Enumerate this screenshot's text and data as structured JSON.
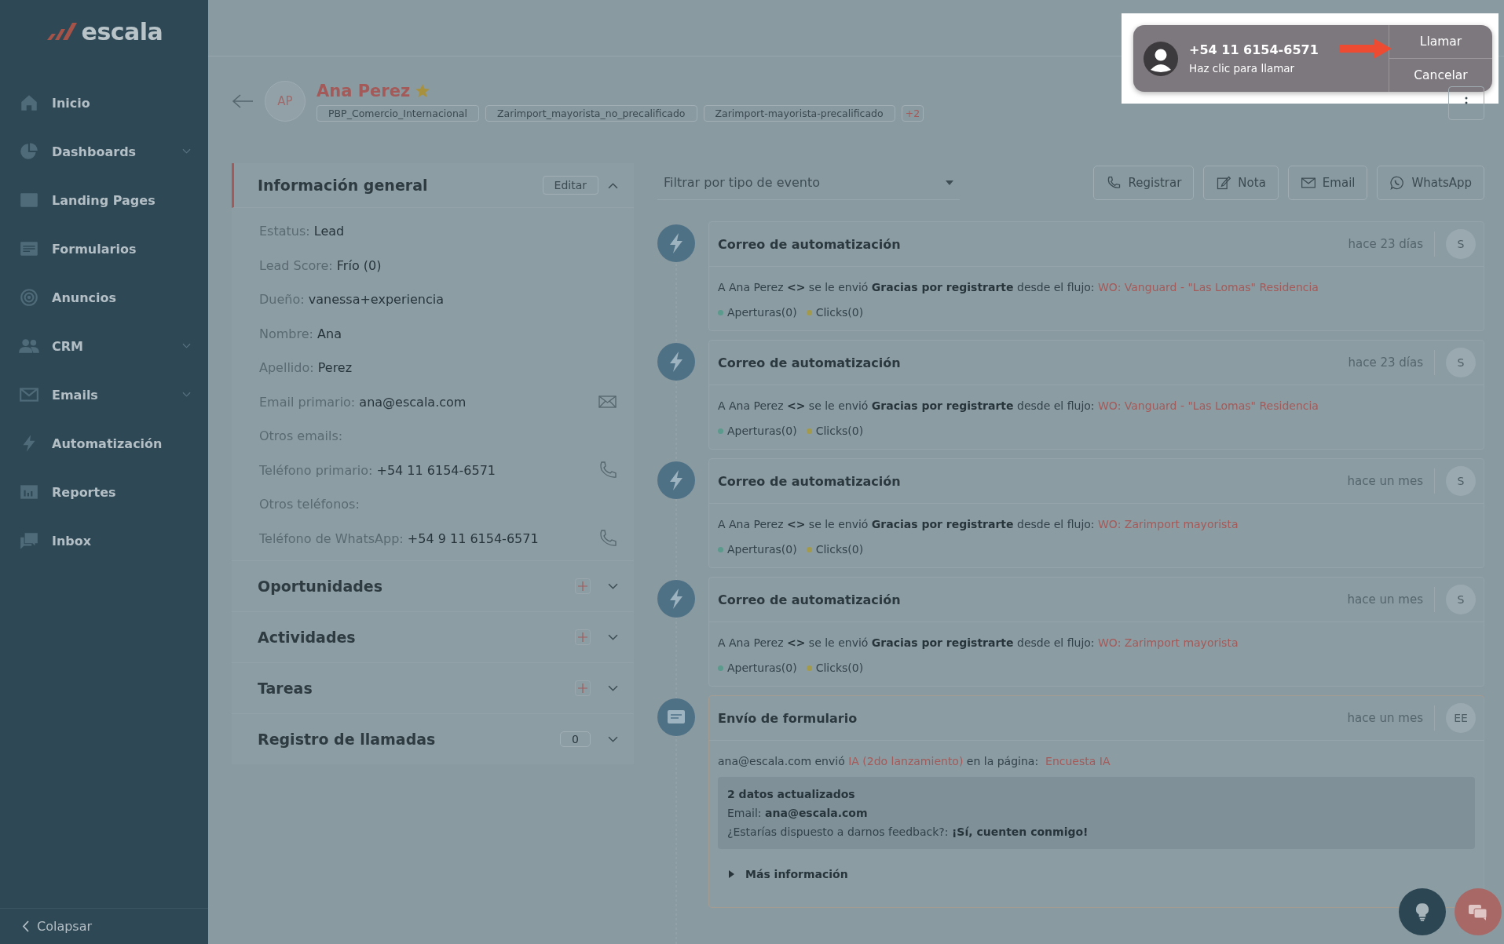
{
  "sidebar": {
    "logo": "escala",
    "items": [
      {
        "label": "Inicio",
        "expandable": false
      },
      {
        "label": "Dashboards",
        "expandable": true
      },
      {
        "label": "Landing Pages",
        "expandable": false
      },
      {
        "label": "Formularios",
        "expandable": false
      },
      {
        "label": "Anuncios",
        "expandable": false
      },
      {
        "label": "CRM",
        "expandable": true
      },
      {
        "label": "Emails",
        "expandable": true
      },
      {
        "label": "Automatización",
        "expandable": false
      },
      {
        "label": "Reportes",
        "expandable": false
      },
      {
        "label": "Inbox",
        "expandable": false
      }
    ],
    "collapse": "Colapsar"
  },
  "contact": {
    "initials": "AP",
    "name": "Ana Perez",
    "starred": true,
    "tags": [
      "PBP_Comercio_Internacional",
      "Zarimport_mayorista_no_precalificado",
      "Zarimport-mayorista-precalificado"
    ],
    "more_tags": "+2"
  },
  "call_popup": {
    "number": "+54 11 6154-6571",
    "hint": "Haz clic para llamar",
    "buttons": [
      "Llamar",
      "Cancelar"
    ]
  },
  "info_panel": {
    "title": "Información general",
    "edit": "Editar",
    "expanded": true,
    "fields": [
      {
        "kind": "text",
        "label": "Estatus:",
        "value": "Lead"
      },
      {
        "kind": "text",
        "label": "Lead Score:",
        "value": "Frío (0)"
      },
      {
        "kind": "text",
        "label": "Dueño:",
        "value": "vanessa+experiencia"
      },
      {
        "kind": "text",
        "label": "Nombre:",
        "value": "Ana"
      },
      {
        "kind": "text",
        "label": "Apellido:",
        "value": "Perez"
      },
      {
        "kind": "email",
        "label": "Email primario:",
        "value": "ana@escala.com"
      },
      {
        "kind": "text",
        "label": "Otros emails:"
      },
      {
        "kind": "phone",
        "label": "Teléfono primario:",
        "value": "+54 11 6154-6571"
      },
      {
        "kind": "text",
        "label": "Otros teléfonos:"
      },
      {
        "kind": "phone",
        "label": "Teléfono de WhatsApp:",
        "value": "+54 9 11 6154-6571"
      }
    ],
    "sections": [
      {
        "title": "Oportunidades",
        "kind": "add"
      },
      {
        "title": "Actividades",
        "kind": "add"
      },
      {
        "title": "Tareas",
        "kind": "add"
      },
      {
        "title": "Registro de llamadas",
        "kind": "count",
        "count": "0"
      }
    ]
  },
  "timeline": {
    "filter": {
      "placeholder": "Filtrar por tipo de evento"
    },
    "actions": [
      "Registrar",
      "Nota",
      "Email",
      "WhatsApp"
    ],
    "events": [
      {
        "kind": "automation",
        "title": "Correo de automatización",
        "time": "hace 23 días",
        "avatar": "S",
        "text": "A Ana Perez **<>** se le envió **Gracias por registrarte** desde el flujo:",
        "link": "WO: Vanguard - \"Las Lomas\" Residencia",
        "stats": [
          {
            "label": "Aperturas(0)",
            "color": "#5b9a8c"
          },
          {
            "label": "Clicks(0)",
            "color": "#a39a4c"
          }
        ]
      },
      {
        "kind": "automation",
        "title": "Correo de automatización",
        "time": "hace 23 días",
        "avatar": "S",
        "text": "A Ana Perez **<>** se le envió **Gracias por registrarte** desde el flujo:",
        "link": "WO: Vanguard - \"Las Lomas\" Residencia",
        "stats": [
          {
            "label": "Aperturas(0)",
            "color": "#5b9a8c"
          },
          {
            "label": "Clicks(0)",
            "color": "#a39a4c"
          }
        ]
      },
      {
        "kind": "automation",
        "title": "Correo de automatización",
        "time": "hace un mes",
        "avatar": "S",
        "text": "A Ana Perez **<>** se le envió **Gracias por registrarte** desde el flujo:",
        "link": "WO: Zarimport mayorista",
        "stats": [
          {
            "label": "Aperturas(0)",
            "color": "#5b9a8c"
          },
          {
            "label": "Clicks(0)",
            "color": "#a39a4c"
          }
        ]
      },
      {
        "kind": "automation",
        "title": "Correo de automatización",
        "time": "hace un mes",
        "avatar": "S",
        "text": "A Ana Perez **<>** se le envió **Gracias por registrarte** desde el flujo:",
        "link": "WO: Zarimport mayorista",
        "stats": [
          {
            "label": "Aperturas(0)",
            "color": "#5b9a8c"
          },
          {
            "label": "Clicks(0)",
            "color": "#a39a4c"
          }
        ]
      },
      {
        "kind": "form",
        "title": "Envío de formulario",
        "time": "hace un mes",
        "avatar": "EE",
        "sender": "ana@escala.com envió",
        "form_link": "IA (2do lanzamiento)",
        "page_label": "en la página:",
        "page_link": "Encuesta IA",
        "updates_title": "2 datos actualizados",
        "updates": [
          "Email: **ana@escala.com**",
          "¿Estarías dispuesto a darnos feedback?: **¡Sí, cuenten conmigo!**"
        ],
        "more": "Más información"
      }
    ]
  }
}
